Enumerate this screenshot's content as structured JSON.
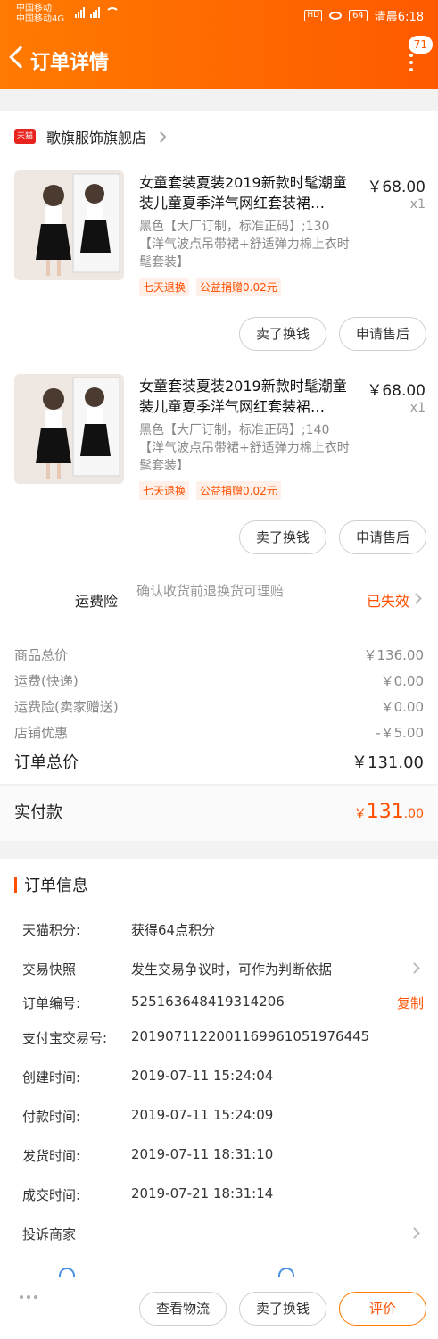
{
  "status_bar": {
    "carrier_1": "中国移动",
    "carrier_2": "中国移动4G",
    "battery": "64",
    "time": "清晨6:18"
  },
  "header": {
    "title": "订单详情",
    "badge_count": "71"
  },
  "shop": {
    "platform_icon": "天猫",
    "name": "歌旗服饰旗舰店"
  },
  "products": [
    {
      "title": "女童套装夏装2019新款时髦潮童装儿童夏季洋气网红套装裙…",
      "price": "￥68.00",
      "qty": "x1",
      "sku": "黑色【大厂订制，标准正码】;130【洋气波点吊带裙+舒适弹力棉上衣时髦套装】",
      "tags": [
        "七天退换",
        "公益捐赠0.02元"
      ],
      "btn_sell": "卖了换钱",
      "btn_after": "申请售后"
    },
    {
      "title": "女童套装夏装2019新款时髦潮童装儿童夏季洋气网红套装裙…",
      "price": "￥68.00",
      "qty": "x1",
      "sku": "黑色【大厂订制，标准正码】;140【洋气波点吊带裙+舒适弹力棉上衣时髦套装】",
      "tags": [
        "七天退换",
        "公益捐赠0.02元"
      ],
      "btn_sell": "卖了换钱",
      "btn_after": "申请售后"
    }
  ],
  "insurance": {
    "label": "运费险",
    "desc": "确认收货前退换货可理赔",
    "status": "已失效"
  },
  "fees": [
    {
      "label": "商品总价",
      "value": "￥136.00"
    },
    {
      "label": "运费(快递)",
      "value": "￥0.00"
    },
    {
      "label": "运费险(卖家赠送)",
      "value": "￥0.00"
    },
    {
      "label": "店铺优惠",
      "value": "-￥5.00"
    }
  ],
  "order_total": {
    "label": "订单总价",
    "value": "￥131.00"
  },
  "paid": {
    "label": "实付款",
    "currency": "￥",
    "int": "131",
    "dec": ".00"
  },
  "order_info": {
    "title": "订单信息",
    "rows": [
      {
        "key": "天猫积分:",
        "value": "获得64点积分"
      },
      {
        "key": "交易快照",
        "value": "发生交易争议时，可作为判断依据"
      },
      {
        "key": "订单编号:",
        "value": "525163648419314206",
        "action": "复制"
      },
      {
        "key": "支付宝交易号:",
        "value": "2019071122001169961051976445"
      },
      {
        "key": "创建时间:",
        "value": "2019-07-11 15:24:04"
      },
      {
        "key": "付款时间:",
        "value": "2019-07-11 15:24:09"
      },
      {
        "key": "发货时间:",
        "value": "2019-07-11 18:31:10"
      },
      {
        "key": "成交时间:",
        "value": "2019-07-21 18:31:14"
      },
      {
        "key": "投诉商家",
        "value": ""
      }
    ]
  },
  "footer": {
    "logistics": "查看物流",
    "sell": "卖了换钱",
    "review": "评价"
  },
  "colors": {
    "header_start": "#ff7a00",
    "header_end": "#ff5a00",
    "accent": "#ff5000",
    "tmall_red": "#e8231f"
  }
}
